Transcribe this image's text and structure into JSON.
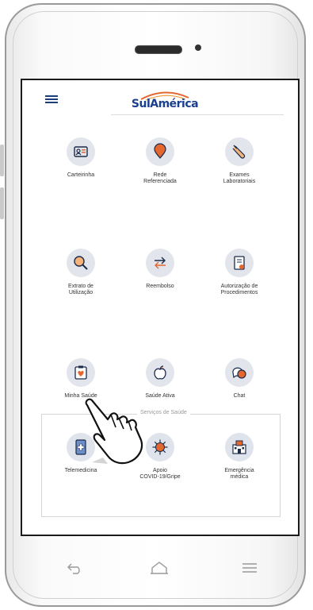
{
  "app": {
    "brand": "SulAmérica",
    "brand_color": "#1b3f8f",
    "accent_color": "#e4672f"
  },
  "header": {
    "menu_icon": "hamburger-menu-icon"
  },
  "grid": [
    {
      "label": "Carteirinha",
      "icon": "id-card-icon"
    },
    {
      "label": "Rede\nReferenciada",
      "icon": "map-pin-icon"
    },
    {
      "label": "Exames\nLaboratoriais",
      "icon": "test-tube-icon"
    },
    {
      "label": "Extrato de\nUtilização",
      "icon": "magnifier-icon"
    },
    {
      "label": "Reembolso",
      "icon": "exchange-arrows-icon"
    },
    {
      "label": "Autorização de\nProcedimentos",
      "icon": "document-check-icon"
    },
    {
      "label": "Minha Saúde",
      "icon": "clipboard-heart-icon"
    },
    {
      "label": "Saúde Ativa",
      "icon": "apple-icon"
    },
    {
      "label": "Chat",
      "icon": "chat-bubbles-icon"
    }
  ],
  "services": {
    "title": "Serviços de Saúde",
    "items": [
      {
        "label": "Telemedicina",
        "icon": "tablet-medical-icon"
      },
      {
        "label": "Apoio\nCOVID-19/Gripe",
        "icon": "virus-icon"
      },
      {
        "label": "Emergência\nmédica",
        "icon": "hospital-icon"
      }
    ]
  },
  "nav": {
    "back": "back-arrow-icon",
    "home": "home-icon",
    "recents": "recents-icon"
  }
}
